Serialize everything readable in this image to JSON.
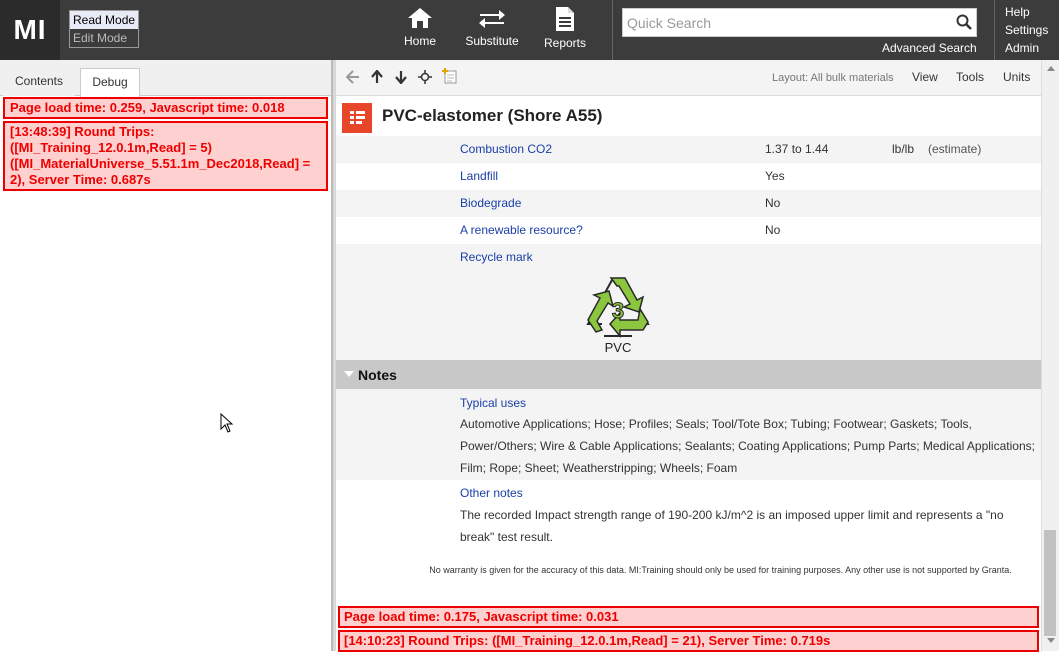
{
  "header": {
    "logo": "MI",
    "read_mode": "Read Mode",
    "edit_mode": "Edit Mode",
    "nav": {
      "home": "Home",
      "substitute": "Substitute",
      "reports": "Reports"
    },
    "search_placeholder": "Quick Search",
    "advanced_search": "Advanced Search",
    "right_menu": {
      "help": "Help",
      "settings": "Settings",
      "admin": "Admin"
    }
  },
  "left_panel": {
    "tabs": {
      "contents": "Contents",
      "debug": "Debug"
    },
    "debug_line1": "Page load time: 0.259, Javascript time: 0.018",
    "debug_line2": "[13:48:39] Round Trips: ([MI_Training_12.0.1m,Read] = 5) ([MI_MaterialUniverse_5.51.1m_Dec2018,Read] = 2), Server Time: 0.687s"
  },
  "toolbar": {
    "layout": "Layout: All bulk materials",
    "view": "View",
    "tools": "Tools",
    "units": "Units"
  },
  "record": {
    "title": "PVC-elastomer (Shore A55)"
  },
  "attributes": [
    {
      "name": "Combustion CO2",
      "value": "1.37 to 1.44",
      "unit": "lb/lb",
      "note": "(estimate)"
    },
    {
      "name": "Landfill",
      "value": "Yes",
      "unit": "",
      "note": ""
    },
    {
      "name": "Biodegrade",
      "value": "No",
      "unit": "",
      "note": ""
    },
    {
      "name": "A renewable resource?",
      "value": "No",
      "unit": "",
      "note": ""
    },
    {
      "name": "Recycle mark",
      "value": "",
      "unit": "",
      "note": ""
    }
  ],
  "recycle_mark": {
    "number": "3",
    "label": "PVC"
  },
  "notes": {
    "header": "Notes",
    "typical_uses_title": "Typical uses",
    "typical_uses_text": "Automotive Applications; Hose; Profiles; Seals; Tool/Tote Box; Tubing; Footwear; Gaskets; Tools, Power/Others; Wire & Cable Applications; Sealants; Coating Applications; Pump Parts; Medical Applications; Film; Rope; Sheet; Weatherstripping; Wheels; Foam",
    "other_notes_title": "Other notes",
    "other_notes_text": "The recorded Impact strength range of 190-200 kJ/m^2 is an imposed upper limit and represents a \"no break\" test result."
  },
  "warranty": "No warranty is given for the accuracy of this data. MI:Training should only be used for training purposes. Any other use is not supported by Granta.",
  "debug_bottom": {
    "line1": "Page load time: 0.175, Javascript time: 0.031",
    "line2": "[14:10:23] Round Trips: ([MI_Training_12.0.1m,Read] = 21), Server Time: 0.719s"
  },
  "colors": {
    "header_bg": "#3c3c3c",
    "link": "#1a3ea8",
    "debug_red": "#e00",
    "debug_bg": "#ffd0d0",
    "record_icon": "#e8462a",
    "recycle_green": "#8cc63f"
  }
}
